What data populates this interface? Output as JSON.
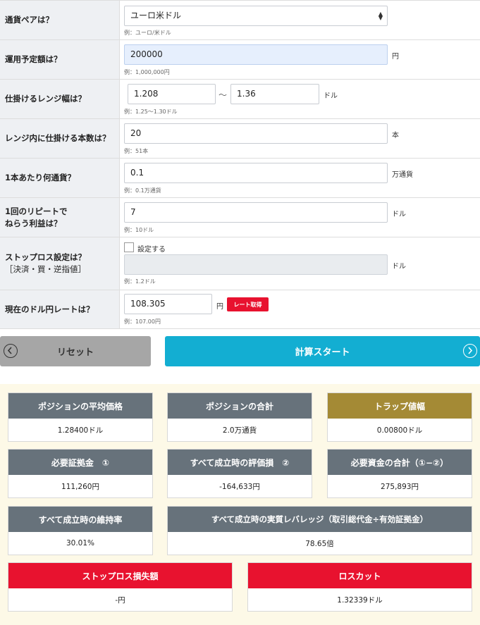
{
  "form": {
    "currency_pair": {
      "label": "通貨ペアは？",
      "value": "ユーロ米ドル",
      "hint": "例：ユーロ/米ドル"
    },
    "amount": {
      "label": "運用予定額は？",
      "value": "200000",
      "unit": "円",
      "hint": "例：1,000,000円"
    },
    "range": {
      "label": "仕掛けるレンジ幅は？",
      "from": "1.208",
      "separator": "〜",
      "to": "1.36",
      "unit": "ドル",
      "hint": "例：1.25〜1.30ドル"
    },
    "count": {
      "label": "レンジ内に仕掛ける本数は？",
      "value": "20",
      "unit": "本",
      "hint": "例：51本"
    },
    "per_unit": {
      "label": "1本あたり何通貨？",
      "value": "0.1",
      "unit": "万通貨",
      "hint": "例：0.1万通貨"
    },
    "profit": {
      "label_line1": "1回のリピートで",
      "label_line2": "ねらう利益は？",
      "value": "7",
      "unit": "ドル",
      "hint": "例：10ドル"
    },
    "stoploss": {
      "label_line1": "ストップロス設定は？",
      "label_line2": "［決済・買・逆指値］",
      "checkbox_label": "設定する",
      "value": "",
      "unit": "ドル",
      "hint": "例：1.2ドル"
    },
    "usdjpy": {
      "label": "現在のドル円レートは？",
      "value": "108.305",
      "unit": "円",
      "button": "レート取得",
      "hint": "例：107.00円"
    }
  },
  "buttons": {
    "reset": "リセット",
    "calc": "計算スタート"
  },
  "results": {
    "avg_price": {
      "title": "ポジションの平均価格",
      "value": "1.28400ドル"
    },
    "total_pos": {
      "title": "ポジションの合計",
      "value": "2.0万通貨"
    },
    "trap_width": {
      "title": "トラップ値幅",
      "value": "0.00800ドル"
    },
    "margin": {
      "title": "必要証拠金　①",
      "value": "111,260円"
    },
    "eval_loss": {
      "title": "すべて成立時の評価損　②",
      "value": "-164,633円"
    },
    "total_funds": {
      "title": "必要資金の合計（①−②）",
      "value": "275,893円"
    },
    "maint_rate": {
      "title": "すべて成立時の維持率",
      "value": "30.01%"
    },
    "leverage": {
      "title": "すべて成立時の実質レバレッジ（取引総代金÷有効証拠金）",
      "value": "78.65倍"
    },
    "sl_loss": {
      "title": "ストップロス損失額",
      "value": "-円"
    },
    "losscut": {
      "title": "ロスカット",
      "value": "1.32339ドル"
    }
  },
  "colors": {
    "accent": "#13aed2",
    "red": "#e8122f",
    "gold": "#a48a35",
    "header_gray": "#67727b"
  }
}
